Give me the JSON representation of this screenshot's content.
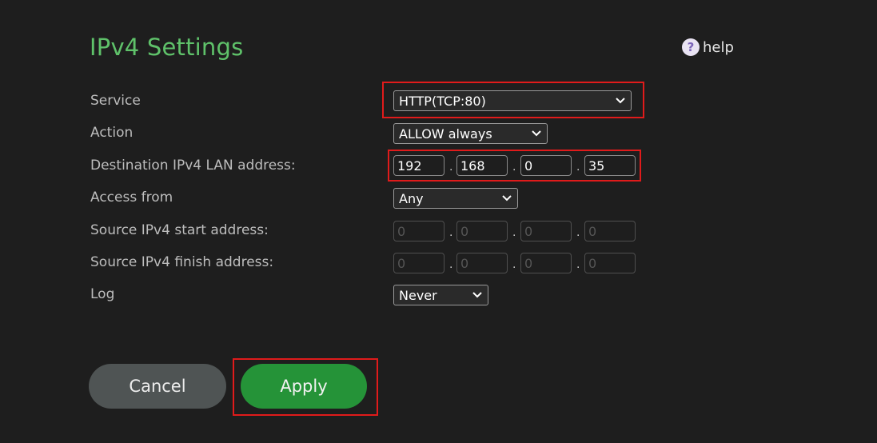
{
  "header": {
    "title": "IPv4 Settings",
    "help_label": "help",
    "help_icon_glyph": "?"
  },
  "form": {
    "service": {
      "label": "Service",
      "value": "HTTP(TCP:80)"
    },
    "action": {
      "label": "Action",
      "value": "ALLOW always"
    },
    "destination": {
      "label": "Destination IPv4 LAN address:",
      "octets": [
        "192",
        "168",
        "0",
        "35"
      ]
    },
    "access_from": {
      "label": "Access from",
      "value": "Any"
    },
    "source_start": {
      "label": "Source IPv4 start address:",
      "octets": [
        "0",
        "0",
        "0",
        "0"
      ]
    },
    "source_finish": {
      "label": "Source IPv4 finish address:",
      "octets": [
        "0",
        "0",
        "0",
        "0"
      ]
    },
    "log": {
      "label": "Log",
      "value": "Never"
    },
    "separator": "."
  },
  "buttons": {
    "cancel": "Cancel",
    "apply": "Apply"
  },
  "colors": {
    "title": "#5fc26a",
    "apply_bg": "#259338",
    "cancel_bg": "#4f5454",
    "highlight_frame": "#e01b1b"
  }
}
